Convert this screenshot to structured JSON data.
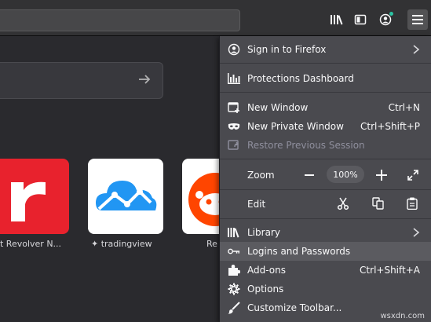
{
  "toolbar": {
    "icons": [
      "library-icon",
      "sidebar-icon",
      "account-icon",
      "hamburger-menu-icon"
    ]
  },
  "newtab": {
    "tiles": [
      {
        "label": "t Revolver N...",
        "letter": "r",
        "color": "#e8222d"
      },
      {
        "label": "tradingview",
        "pinned": true,
        "color": "#ffffff"
      },
      {
        "label": "Re",
        "color": "#ffffff"
      }
    ]
  },
  "menu": {
    "signin": "Sign in to Firefox",
    "protections": "Protections Dashboard",
    "new_window": {
      "label": "New Window",
      "shortcut": "Ctrl+N"
    },
    "new_private": {
      "label": "New Private Window",
      "shortcut": "Ctrl+Shift+P"
    },
    "restore": "Restore Previous Session",
    "zoom": {
      "label": "Zoom",
      "value": "100%"
    },
    "edit": {
      "label": "Edit"
    },
    "library": "Library",
    "logins": "Logins and Passwords",
    "addons": {
      "label": "Add-ons",
      "shortcut": "Ctrl+Shift+A"
    },
    "options": "Options",
    "customize": "Customize Toolbar..."
  },
  "watermark": "wsxdn.com"
}
